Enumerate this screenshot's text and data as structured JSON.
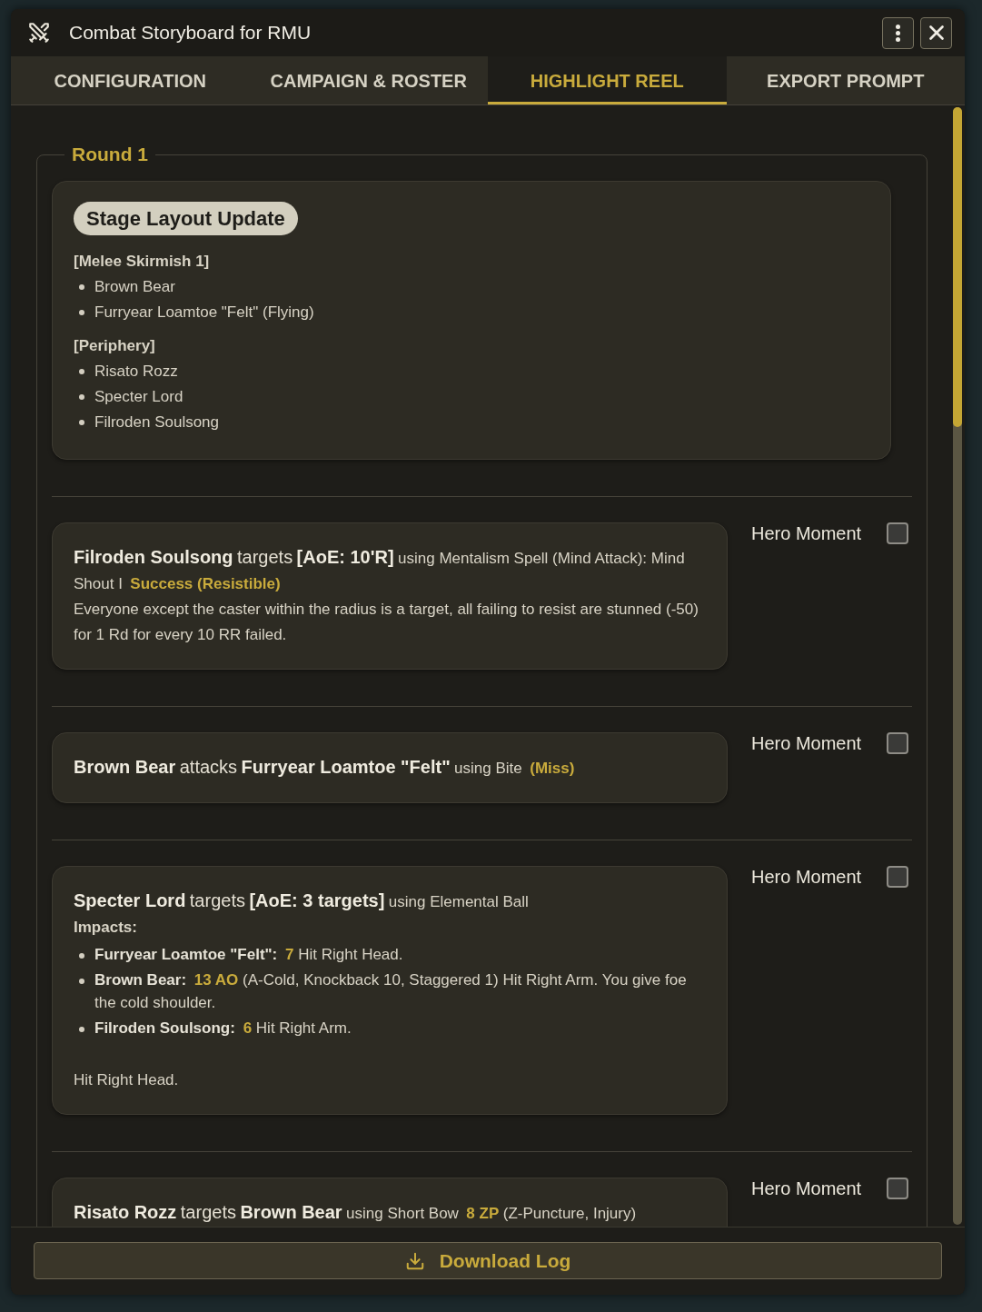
{
  "window": {
    "title": "Combat Storyboard for RMU"
  },
  "tabs": [
    {
      "label": "CONFIGURATION",
      "selected": false
    },
    {
      "label": "CAMPAIGN & ROSTER",
      "selected": false
    },
    {
      "label": "HIGHLIGHT REEL",
      "selected": true
    },
    {
      "label": "EXPORT PROMPT",
      "selected": false
    }
  ],
  "round": {
    "legend": "Round 1",
    "stage_update": {
      "badge": "Stage Layout Update",
      "groups": [
        {
          "heading": "[Melee Skirmish 1]",
          "items": [
            "Brown Bear",
            "Furryear Loamtoe \"Felt\" (Flying)"
          ]
        },
        {
          "heading": "[Periphery]",
          "items": [
            "Risato Rozz",
            "Specter Lord",
            "Filroden Soulsong"
          ]
        }
      ]
    },
    "events": [
      {
        "summary": [
          {
            "kind": "actor",
            "text": "Filroden Soulsong"
          },
          {
            "kind": "action",
            "text": "targets"
          },
          {
            "kind": "target",
            "text": "[AoE: 10'R]"
          },
          {
            "kind": "method",
            "text": "using Mentalism Spell (Mind Attack): Mind Shout I"
          },
          {
            "kind": "result",
            "text": "Success (Resistible)"
          }
        ],
        "description": "Everyone except the caster within the radius is a target, all failing to resist are stunned (-50) for 1 Rd for every 10 RR failed.",
        "hero_moment": {
          "label": "Hero Moment",
          "checked": false
        }
      },
      {
        "summary": [
          {
            "kind": "actor",
            "text": "Brown Bear"
          },
          {
            "kind": "action",
            "text": "attacks"
          },
          {
            "kind": "target",
            "text": "Furryear Loamtoe \"Felt\""
          },
          {
            "kind": "method",
            "text": "using Bite"
          },
          {
            "kind": "result",
            "text": "(Miss)"
          }
        ],
        "hero_moment": {
          "label": "Hero Moment",
          "checked": false
        }
      },
      {
        "summary": [
          {
            "kind": "actor",
            "text": "Specter Lord"
          },
          {
            "kind": "action",
            "text": "targets"
          },
          {
            "kind": "target",
            "text": "[AoE: 3 targets]"
          },
          {
            "kind": "method",
            "text": "using Elemental Ball"
          }
        ],
        "impacts_label": "Impacts:",
        "impacts": [
          {
            "target": "Furryear Loamtoe \"Felt\":",
            "result": "7",
            "effect": "Hit Right Head."
          },
          {
            "target": "Brown Bear:",
            "result": "13 AO",
            "effect": "(A-Cold, Knockback 10, Staggered 1) Hit Right Arm. You give foe the cold shoulder."
          },
          {
            "target": "Filroden Soulsong:",
            "result": "6",
            "effect": "Hit Right Arm."
          }
        ],
        "description": "Hit Right Head.",
        "hero_moment": {
          "label": "Hero Moment",
          "checked": false
        }
      },
      {
        "summary": [
          {
            "kind": "actor",
            "text": "Risato Rozz"
          },
          {
            "kind": "action",
            "text": "targets"
          },
          {
            "kind": "target",
            "text": "Brown Bear"
          },
          {
            "kind": "method",
            "text": "using Short Bow"
          },
          {
            "kind": "result",
            "text": "8 ZP"
          },
          {
            "kind": "detail",
            "text": "(Z-Puncture, Injury)"
          }
        ],
        "hero_moment": {
          "label": "Hero Moment",
          "checked": false
        }
      }
    ]
  },
  "footer": {
    "button": "Download Log"
  }
}
